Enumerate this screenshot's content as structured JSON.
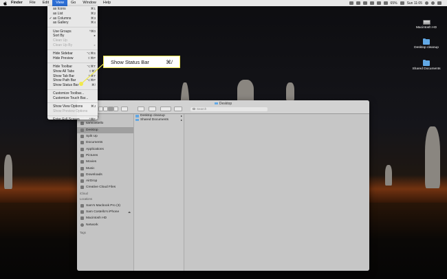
{
  "menubar": {
    "items": [
      "Finder",
      "File",
      "Edit",
      "View",
      "Go",
      "Window",
      "Help"
    ],
    "active": "View",
    "clock": "Sun 11:05",
    "battery": "65%"
  },
  "desktop_icons": [
    {
      "label": "Macintosh HD",
      "type": "hd"
    },
    {
      "label": "Desktop cleanup",
      "type": "folder"
    },
    {
      "label": "Shared Documents",
      "type": "folder"
    }
  ],
  "view_menu": {
    "groups": [
      [
        {
          "label": "as Icons",
          "key": "⌘1",
          "checked": false,
          "disabled": false
        },
        {
          "label": "as List",
          "key": "⌘2",
          "checked": false,
          "disabled": false
        },
        {
          "label": "as Columns",
          "key": "⌘3",
          "checked": true,
          "disabled": false
        },
        {
          "label": "as Gallery",
          "key": "⌘4",
          "checked": false,
          "disabled": false
        }
      ],
      [
        {
          "label": "Use Groups",
          "key": "^⌘0",
          "checked": false,
          "disabled": false
        },
        {
          "label": "Sort By",
          "key": "▸",
          "checked": false,
          "disabled": false
        },
        {
          "label": "Clean Up",
          "key": "",
          "checked": false,
          "disabled": true
        },
        {
          "label": "Clean Up By",
          "key": "▸",
          "checked": false,
          "disabled": true
        }
      ],
      [
        {
          "label": "Hide Sidebar",
          "key": "⌥⌘S",
          "checked": false,
          "disabled": false
        },
        {
          "label": "Hide Preview",
          "key": "⇧⌘P",
          "checked": false,
          "disabled": false
        }
      ],
      [
        {
          "label": "Hide Toolbar",
          "key": "⌥⌘T",
          "checked": false,
          "disabled": false
        },
        {
          "label": "Show All Tabs",
          "key": "⇧⌘\\",
          "checked": false,
          "disabled": false
        },
        {
          "label": "Show Tab Bar",
          "key": "⇧⌘T",
          "checked": false,
          "disabled": false
        },
        {
          "label": "Show Path Bar",
          "key": "⌥⌘P",
          "checked": false,
          "disabled": false
        },
        {
          "label": "Show Status Bar",
          "key": "⌘/",
          "checked": false,
          "disabled": false
        }
      ],
      [
        {
          "label": "Customize Toolbar...",
          "key": "",
          "checked": false,
          "disabled": false
        },
        {
          "label": "Customize Touch Bar...",
          "key": "",
          "checked": false,
          "disabled": false
        }
      ],
      [
        {
          "label": "Show View Options",
          "key": "⌘J",
          "checked": false,
          "disabled": false
        },
        {
          "label": "Show Preview Options",
          "key": "",
          "checked": false,
          "disabled": true
        }
      ],
      [
        {
          "label": "Enter Full Screen",
          "key": "^⌘F",
          "checked": false,
          "disabled": false
        }
      ]
    ]
  },
  "callout": {
    "label": "Show Status Bar",
    "key": "⌘/"
  },
  "finder": {
    "title": "Desktop",
    "search_placeholder": "Search",
    "sidebar": {
      "favorites": [
        {
          "label": "Dropbox",
          "icon": "dropbox-icon",
          "selected": false
        },
        {
          "label": "samcostello",
          "icon": "home-icon",
          "selected": false
        },
        {
          "label": "Desktop",
          "icon": "desktop-icon",
          "selected": true
        },
        {
          "label": "Split Up",
          "icon": "folder-icon",
          "selected": false
        },
        {
          "label": "Documents",
          "icon": "documents-icon",
          "selected": false
        },
        {
          "label": "Applications",
          "icon": "applications-icon",
          "selected": false
        },
        {
          "label": "Pictures",
          "icon": "pictures-icon",
          "selected": false
        },
        {
          "label": "Movies",
          "icon": "movies-icon",
          "selected": false
        },
        {
          "label": "Music",
          "icon": "music-icon",
          "selected": false
        },
        {
          "label": "Downloads",
          "icon": "downloads-icon",
          "selected": false
        },
        {
          "label": "AirDrop",
          "icon": "airdrop-icon",
          "selected": false
        },
        {
          "label": "Creative Cloud Files",
          "icon": "creative-cloud-icon",
          "selected": false
        }
      ],
      "icloud_heading": "iCloud",
      "locations_heading": "Locations",
      "locations": [
        {
          "label": "Sam's Macbook Pro (3)",
          "icon": "laptop-icon",
          "eject": false
        },
        {
          "label": "Sam Costello's iPhone",
          "icon": "iphone-icon",
          "eject": true
        },
        {
          "label": "Macintosh HD",
          "icon": "hard-drive-icon",
          "eject": false
        },
        {
          "label": "Network",
          "icon": "network-icon",
          "eject": false
        }
      ],
      "tags_heading": "Tags"
    },
    "column_items": [
      {
        "label": "Desktop cleanup",
        "has_children": true
      },
      {
        "label": "Shared Documents",
        "has_children": true
      }
    ]
  }
}
